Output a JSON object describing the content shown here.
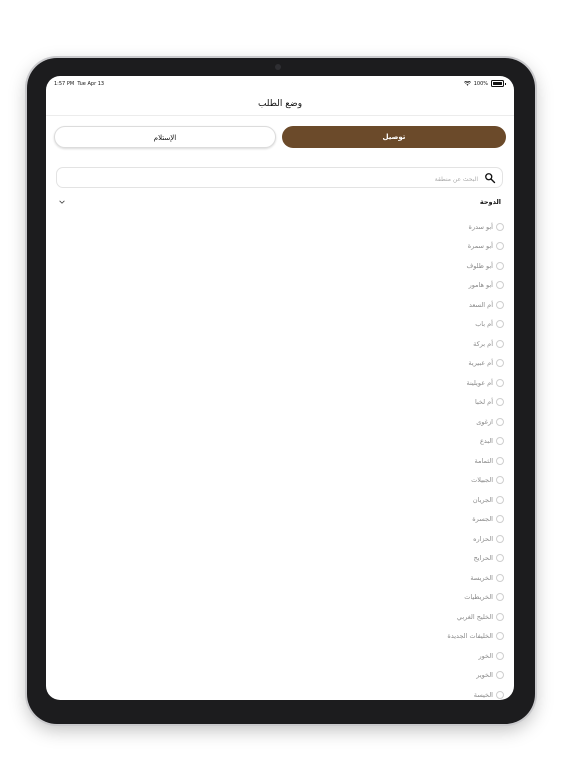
{
  "status_bar": {
    "time": "1:57 PM",
    "date": "Tue Apr 13",
    "battery": "100%",
    "wifi_icon": "wifi-icon"
  },
  "header": {
    "title": "وضع الطلب"
  },
  "tabs": {
    "delivery": "توصيل",
    "pickup": "الإستلام",
    "selected": "delivery"
  },
  "search": {
    "placeholder": "البحث عن منطقة",
    "value": ""
  },
  "region": {
    "label": "الدوحة",
    "expanded": true
  },
  "areas": [
    "أبو سدرة",
    "أبو سمرة",
    "أبو ظلوف",
    "أبو هامور",
    "أم السعد",
    "أم باب",
    "أم بركة",
    "أم عبيرية",
    "أم عويلينة",
    "أم لخبا",
    "ازغوى",
    "البدع",
    "الثمامة",
    "الجبيلات",
    "الجريان",
    "الجسرة",
    "الحزاره",
    "الحرايج",
    "الخريسة",
    "الخريطيات",
    "الخليج الغربي",
    "الخليفات الجديدة",
    "الخور",
    "الخوير",
    "الخيسة"
  ],
  "colors": {
    "accent": "#6b4a2a",
    "device_frame": "#1c1c1e"
  }
}
